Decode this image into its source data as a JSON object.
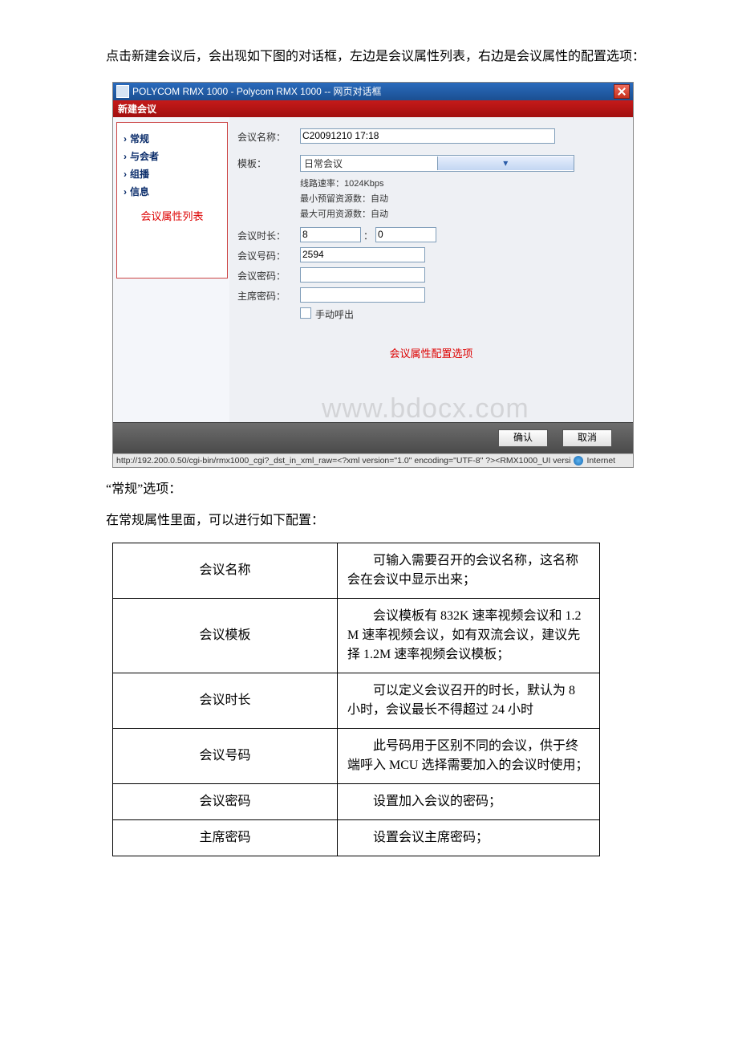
{
  "intro": "点击新建会议后，会出现如下图的对话框，左边是会议属性列表，右边是会议属性的配置选项：",
  "titlebar": "POLYCOM RMX 1000 - Polycom RMX 1000 -- 网页对话框",
  "dialogHeader": "新建会议",
  "nav": {
    "general": "常规",
    "participants": "与会者",
    "multicast": "组播",
    "info": "信息"
  },
  "leftNote": "会议属性列表",
  "form": {
    "nameLabel": "会议名称：",
    "nameValue": "C20091210 17:18",
    "tplLabel": "模板：",
    "tplValue": "日常会议",
    "rate": "线路速率：1024Kbps",
    "min": "最小预留资源数：自动",
    "max": "最大可用资源数：自动",
    "durLabel": "会议时长：",
    "durH": "8",
    "durM": "0",
    "idLabel": "会议号码：",
    "idValue": "2594",
    "pwdLabel": "会议密码：",
    "chairLabel": "主席密码：",
    "manual": "手动呼出"
  },
  "rightNote": "会议属性配置选项",
  "btnOk": "确认",
  "btnCancel": "取消",
  "watermark": "www.bdocx.com",
  "status": {
    "url": "http://192.200.0.50/cgi-bin/rmx1000_cgi?_dst_in_xml_raw=<?xml version=\"1.0\" encoding=\"UTF-8\" ?><RMX1000_UI versi",
    "zone": "Internet"
  },
  "sec1": "“常规”选项：",
  "sec2": "在常规属性里面，可以进行如下配置：",
  "rowsK": [
    "会议名称",
    "会议模板",
    "会议时长",
    "会议号码",
    "会议密码",
    "主席密码"
  ],
  "rowsV": [
    "可输入需要召开的会议名称，这名称会在会议中显示出来；",
    "会议模板有 832K 速率视频会议和 1.2 M 速率视频会议，如有双流会议，建议先择 1.2M 速率视频会议模板；",
    "可以定义会议召开的时长，默认为 8 小时，会议最长不得超过 24 小时",
    "此号码用于区别不同的会议，供于终端呼入 MCU 选择需要加入的会议时使用；",
    "设置加入会议的密码；",
    "设置会议主席密码；"
  ]
}
